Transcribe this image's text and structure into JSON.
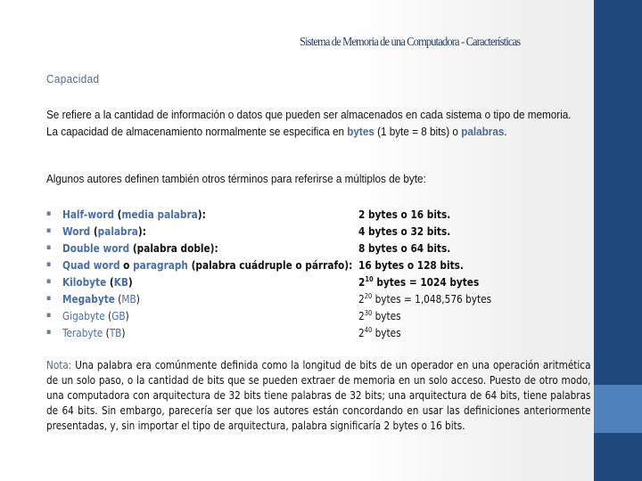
{
  "slide": {
    "title": "Sistema de Memoria de una Computadora -  Características",
    "section_heading": "Capacidad",
    "paragraph1": {
      "before_bytes": "Se refiere a la cantidad de información o datos que pueden ser almacenados en cada sistema o tipo de memoria. La capacidad de almacenamiento normalmente se especifica en ",
      "bytes": "bytes",
      "between": " (1 byte = 8 bits) o ",
      "palabras": "palabras",
      "end": "."
    },
    "paragraph2": "Algunos autores definen también otros términos para referirse a múltiplos de byte:",
    "bullet_glyph": "▪",
    "list": [
      {
        "term": "Half-word",
        "open": " (",
        "alias": "media palabra",
        "close": "):",
        "value": "2 bytes o 16 bits."
      },
      {
        "term": "Word",
        "open": " (",
        "alias": "palabra",
        "close": "):",
        "value": "4 bytes o 32 bits."
      },
      {
        "term": "Double word",
        "open": " (",
        "alias": "palabra doble",
        "close": "):",
        "value": "8 bytes o 64 bits."
      },
      {
        "term": "Quad word",
        "mid": " o ",
        "term2": "paragraph",
        "open": " (",
        "alias": "palabra cuádruple o párrafo",
        "close": "):",
        "value": "16 bytes o 128 bits."
      },
      {
        "term": "Kilobyte",
        "open": " (",
        "alias": "KB",
        "close": ")",
        "value_base": "2",
        "value_exp": "10",
        "value_rest": " bytes = 1024 bytes"
      },
      {
        "term": "Megabyte",
        "open": " (",
        "alias": "MB",
        "close": ")",
        "value_base": "2",
        "value_exp": "20",
        "value_rest": " bytes = 1,048,576 bytes"
      },
      {
        "term": "Gigabyte",
        "open": " (",
        "alias": "GB",
        "close": ")",
        "value_base": "2",
        "value_exp": "30",
        "value_rest": " bytes"
      },
      {
        "term": "Terabyte",
        "open": " (",
        "alias": "TB",
        "close": ")",
        "value_base": "2",
        "value_exp": "40",
        "value_rest": " bytes"
      }
    ],
    "note": {
      "label": "Nota:",
      "text": " Una palabra era comúnmente definida como la longitud de bits de un operador en una operación aritmética de un solo paso, o la cantidad de bits que se pueden extraer de memoria en un solo acceso. Puesto de otro modo, una computadora con arquitectura de 32 bits tiene palabras de 32 bits; una arquitectura de 64 bits, tiene palabras de 64 bits. Sin embargo, parecería ser que los autores están concordando en usar las definiciones anteriormente presentadas, y, sin importar el tipo de arquitectura, palabra significaría 2 bytes o 16 bits."
    }
  },
  "colors": {
    "side_bar": "#1f497d",
    "side_bar_accent": "#4f81bd",
    "title": "#1f3a5f",
    "highlight": "#4f6a8f"
  }
}
